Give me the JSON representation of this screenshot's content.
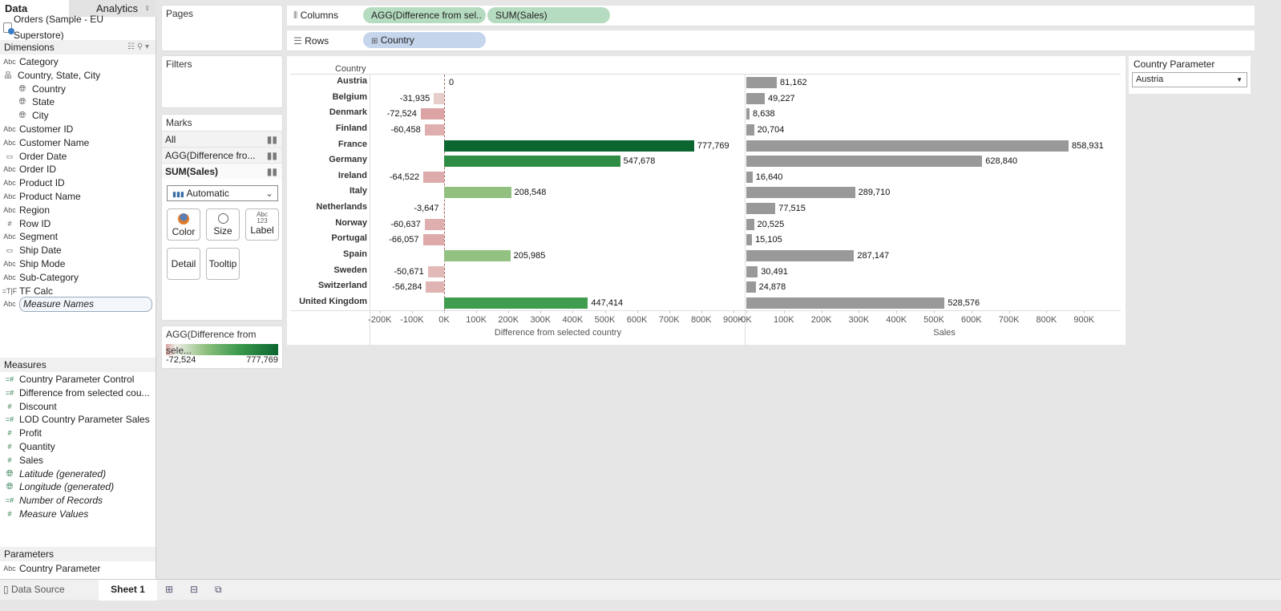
{
  "tabs": {
    "data": "Data",
    "analytics": "Analytics"
  },
  "datasource": "Orders (Sample - EU Superstore)",
  "dimensions": {
    "title": "Dimensions",
    "items": [
      {
        "icon": "Abc",
        "label": "Category",
        "indent": 0
      },
      {
        "icon": "hier",
        "label": "Country, State, City",
        "indent": 0
      },
      {
        "icon": "globe",
        "label": "Country",
        "indent": 1
      },
      {
        "icon": "globe",
        "label": "State",
        "indent": 1
      },
      {
        "icon": "globe",
        "label": "City",
        "indent": 1
      },
      {
        "icon": "Abc",
        "label": "Customer ID",
        "indent": 0
      },
      {
        "icon": "Abc",
        "label": "Customer Name",
        "indent": 0
      },
      {
        "icon": "cal",
        "label": "Order Date",
        "indent": 0
      },
      {
        "icon": "Abc",
        "label": "Order ID",
        "indent": 0
      },
      {
        "icon": "Abc",
        "label": "Product ID",
        "indent": 0
      },
      {
        "icon": "Abc",
        "label": "Product Name",
        "indent": 0
      },
      {
        "icon": "Abc",
        "label": "Region",
        "indent": 0
      },
      {
        "icon": "#",
        "label": "Row ID",
        "indent": 0
      },
      {
        "icon": "Abc",
        "label": "Segment",
        "indent": 0
      },
      {
        "icon": "cal",
        "label": "Ship Date",
        "indent": 0
      },
      {
        "icon": "Abc",
        "label": "Ship Mode",
        "indent": 0
      },
      {
        "icon": "Abc",
        "label": "Sub-Category",
        "indent": 0
      },
      {
        "icon": "=T|F",
        "label": "TF Calc",
        "indent": 0
      },
      {
        "icon": "Abc",
        "label": "Measure Names",
        "indent": 0,
        "italic": true,
        "selected": true
      }
    ]
  },
  "measures": {
    "title": "Measures",
    "items": [
      {
        "icon": "=#",
        "label": "Country Parameter Control"
      },
      {
        "icon": "=#",
        "label": "Difference from selected cou..."
      },
      {
        "icon": "#",
        "label": "Discount"
      },
      {
        "icon": "=#",
        "label": "LOD Country Parameter Sales"
      },
      {
        "icon": "#",
        "label": "Profit"
      },
      {
        "icon": "#",
        "label": "Quantity"
      },
      {
        "icon": "#",
        "label": "Sales"
      },
      {
        "icon": "globe",
        "label": "Latitude (generated)",
        "italic": true
      },
      {
        "icon": "globe",
        "label": "Longitude (generated)",
        "italic": true
      },
      {
        "icon": "=#",
        "label": "Number of Records",
        "italic": true
      },
      {
        "icon": "#",
        "label": "Measure Values",
        "italic": true
      }
    ]
  },
  "parameters": {
    "title": "Parameters",
    "items": [
      {
        "icon": "Abc",
        "label": "Country Parameter"
      }
    ]
  },
  "pages": "Pages",
  "filters": "Filters",
  "marks": {
    "title": "Marks",
    "rows": [
      "All",
      "AGG(Difference fro...",
      "SUM(Sales)"
    ],
    "type": "Automatic",
    "buttons": [
      "Color",
      "Size",
      "Label",
      "Detail",
      "Tooltip"
    ]
  },
  "legend": {
    "title": "AGG(Difference from sele...",
    "min": "-72,524",
    "max": "777,769"
  },
  "shelves": {
    "columns": "Columns",
    "rows": "Rows",
    "col_pills": [
      "AGG(Difference from sel..",
      "SUM(Sales)"
    ],
    "row_pill": "Country"
  },
  "param_card": {
    "title": "Country Parameter",
    "value": "Austria"
  },
  "bottom": {
    "datasource": "Data Source",
    "sheet": "Sheet 1"
  },
  "colors": {
    "neg": "#dba3a3",
    "zero": "#eeeee8",
    "pos": "#0b6630",
    "sales": "#999999"
  },
  "chart_data": {
    "type": "bar",
    "row_header": "Country",
    "categories": [
      "Austria",
      "Belgium",
      "Denmark",
      "Finland",
      "France",
      "Germany",
      "Ireland",
      "Italy",
      "Netherlands",
      "Norway",
      "Portugal",
      "Spain",
      "Sweden",
      "Switzerland",
      "United Kingdom"
    ],
    "series": [
      {
        "name": "Difference from selected country",
        "values": [
          0,
          -31935,
          -72524,
          -60458,
          777769,
          547678,
          -64522,
          208548,
          -3647,
          -60637,
          -66057,
          205985,
          -50671,
          -56284,
          447414
        ],
        "labels": [
          "0",
          "-31,935",
          "-72,524",
          "-60,458",
          "777,769",
          "547,678",
          "-64,522",
          "208,548",
          "-3,647",
          "-60,637",
          "-66,057",
          "205,985",
          "-50,671",
          "-56,284",
          "447,414"
        ],
        "xlim": [
          -220000,
          930000
        ],
        "ticks": [
          "-200K",
          "-100K",
          "0K",
          "100K",
          "200K",
          "300K",
          "400K",
          "500K",
          "600K",
          "700K",
          "800K",
          "900K"
        ],
        "tickvals": [
          -200000,
          -100000,
          0,
          100000,
          200000,
          300000,
          400000,
          500000,
          600000,
          700000,
          800000,
          900000
        ]
      },
      {
        "name": "Sales",
        "values": [
          81162,
          49227,
          8638,
          20704,
          858931,
          628840,
          16640,
          289710,
          77515,
          20525,
          15105,
          287147,
          30491,
          24878,
          528576
        ],
        "labels": [
          "81,162",
          "49,227",
          "8,638",
          "20,704",
          "858,931",
          "628,840",
          "16,640",
          "289,710",
          "77,515",
          "20,525",
          "15,105",
          "287,147",
          "30,491",
          "24,878",
          "528,576"
        ],
        "xlim": [
          0,
          1000000
        ],
        "ticks": [
          "0K",
          "100K",
          "200K",
          "300K",
          "400K",
          "500K",
          "600K",
          "700K",
          "800K",
          "900K"
        ],
        "tickvals": [
          0,
          100000,
          200000,
          300000,
          400000,
          500000,
          600000,
          700000,
          800000,
          900000
        ]
      }
    ]
  }
}
